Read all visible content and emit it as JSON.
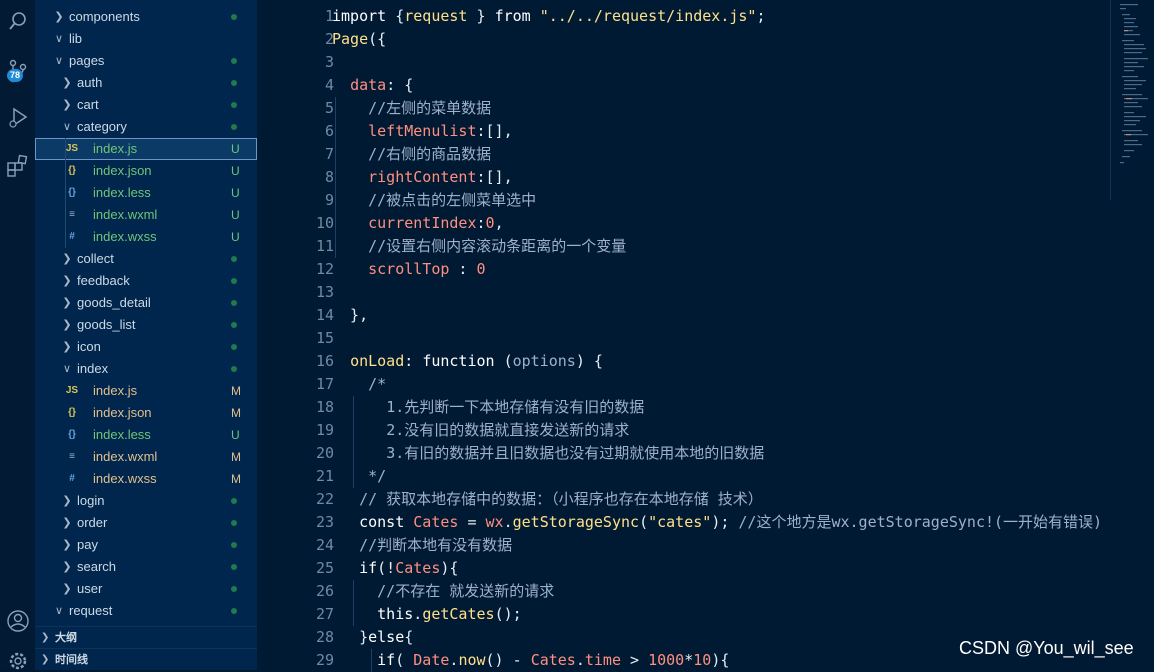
{
  "activity_bar": {
    "scm_badge": "78"
  },
  "explorer": {
    "rows": [
      {
        "label": "components",
        "kind": "folder",
        "open": false,
        "status": "dot"
      },
      {
        "label": "lib",
        "kind": "folder",
        "open": true,
        "status": ""
      },
      {
        "label": "pages",
        "kind": "folder",
        "open": true,
        "status": "dot"
      },
      {
        "label": "auth",
        "kind": "folder",
        "open": false,
        "status": "dot"
      },
      {
        "label": "cart",
        "kind": "folder",
        "open": false,
        "status": "dot"
      },
      {
        "label": "category",
        "kind": "folder",
        "open": true,
        "status": "dot"
      },
      {
        "label": "index.js",
        "kind": "js",
        "status": "U"
      },
      {
        "label": "index.json",
        "kind": "json",
        "status": "U"
      },
      {
        "label": "index.less",
        "kind": "less",
        "status": "U"
      },
      {
        "label": "index.wxml",
        "kind": "wxml",
        "status": "U"
      },
      {
        "label": "index.wxss",
        "kind": "wxss",
        "status": "U"
      },
      {
        "label": "collect",
        "kind": "folder",
        "open": false,
        "status": "dot"
      },
      {
        "label": "feedback",
        "kind": "folder",
        "open": false,
        "status": "dot"
      },
      {
        "label": "goods_detail",
        "kind": "folder",
        "open": false,
        "status": "dot"
      },
      {
        "label": "goods_list",
        "kind": "folder",
        "open": false,
        "status": "dot"
      },
      {
        "label": "icon",
        "kind": "folder",
        "open": false,
        "status": "dot"
      },
      {
        "label": "index",
        "kind": "folder",
        "open": true,
        "status": "dot"
      },
      {
        "label": "index.js",
        "kind": "js",
        "status": "M"
      },
      {
        "label": "index.json",
        "kind": "json",
        "status": "M"
      },
      {
        "label": "index.less",
        "kind": "less",
        "status": "U"
      },
      {
        "label": "index.wxml",
        "kind": "wxml",
        "status": "M"
      },
      {
        "label": "index.wxss",
        "kind": "wxss",
        "status": "M"
      },
      {
        "label": "login",
        "kind": "folder",
        "open": false,
        "status": "dot"
      },
      {
        "label": "order",
        "kind": "folder",
        "open": false,
        "status": "dot"
      },
      {
        "label": "pay",
        "kind": "folder",
        "open": false,
        "status": "dot"
      },
      {
        "label": "search",
        "kind": "folder",
        "open": false,
        "status": "dot"
      },
      {
        "label": "user",
        "kind": "folder",
        "open": false,
        "status": "dot"
      },
      {
        "label": "request",
        "kind": "folder",
        "open": true,
        "status": "dot"
      }
    ],
    "sections": [
      {
        "label": "大纲"
      },
      {
        "label": "时间线"
      }
    ]
  },
  "editor": {
    "line_numbers": [
      "1",
      "2",
      "3",
      "4",
      "5",
      "6",
      "7",
      "8",
      "9",
      "10",
      "11",
      "12",
      "13",
      "14",
      "15",
      "16",
      "17",
      "18",
      "19",
      "20",
      "21",
      "22",
      "23",
      "24",
      "25",
      "26",
      "27",
      "28",
      "29"
    ],
    "lines": [
      [
        [
          "k",
          "import "
        ],
        [
          "op",
          "{"
        ],
        [
          "fn",
          "request"
        ],
        [
          "op",
          " } "
        ],
        [
          "k",
          "from "
        ],
        [
          "str",
          "\"../../request/index.js\""
        ],
        [
          "op",
          ";"
        ]
      ],
      [
        [
          "fn",
          "Page"
        ],
        [
          "op",
          "({"
        ]
      ],
      [],
      [
        [
          "op",
          "  "
        ],
        [
          "prop",
          "data"
        ],
        [
          "op",
          ": {"
        ]
      ],
      [
        [
          "op",
          "    "
        ],
        [
          "cm",
          "//左侧的菜单数据"
        ]
      ],
      [
        [
          "op",
          "    "
        ],
        [
          "prop",
          "leftMenulist"
        ],
        [
          "op",
          ":[],"
        ]
      ],
      [
        [
          "op",
          "    "
        ],
        [
          "cm",
          "//右侧的商品数据"
        ]
      ],
      [
        [
          "op",
          "    "
        ],
        [
          "prop",
          "rightContent"
        ],
        [
          "op",
          ":[],"
        ]
      ],
      [
        [
          "op",
          "    "
        ],
        [
          "cm",
          "//被点击的左侧菜单选中"
        ]
      ],
      [
        [
          "op",
          "    "
        ],
        [
          "prop",
          "currentIndex"
        ],
        [
          "op",
          ":"
        ],
        [
          "num",
          "0"
        ],
        [
          "op",
          ","
        ]
      ],
      [
        [
          "op",
          "    "
        ],
        [
          "cm",
          "//设置右侧内容滚动条距离的一个变量"
        ]
      ],
      [
        [
          "op",
          "    "
        ],
        [
          "prop",
          "scrollTop"
        ],
        [
          "op",
          " : "
        ],
        [
          "num",
          "0"
        ]
      ],
      [],
      [
        [
          "op",
          "  },"
        ]
      ],
      [],
      [
        [
          "op",
          "  "
        ],
        [
          "fn",
          "onLoad"
        ],
        [
          "op",
          ": "
        ],
        [
          "k",
          "function "
        ],
        [
          "op",
          "("
        ],
        [
          "cm",
          "options"
        ],
        [
          "op",
          ") {"
        ]
      ],
      [
        [
          "op",
          "    "
        ],
        [
          "cm",
          "/*"
        ]
      ],
      [
        [
          "op",
          "      "
        ],
        [
          "cm",
          "1.先判断一下本地存储有没有旧的数据"
        ]
      ],
      [
        [
          "op",
          "      "
        ],
        [
          "cm",
          "2.没有旧的数据就直接发送新的请求"
        ]
      ],
      [
        [
          "op",
          "      "
        ],
        [
          "cm",
          "3.有旧的数据并且旧数据也没有过期就使用本地的旧数据"
        ]
      ],
      [
        [
          "op",
          "    "
        ],
        [
          "cm",
          "*/"
        ]
      ],
      [
        [
          "op",
          "   "
        ],
        [
          "cm",
          "// 获取本地存储中的数据：（小程序也存在本地存储 技术）"
        ]
      ],
      [
        [
          "op",
          "   "
        ],
        [
          "k",
          "const "
        ],
        [
          "prop",
          "Cates"
        ],
        [
          "op",
          " = "
        ],
        [
          "prop",
          "wx"
        ],
        [
          "op",
          "."
        ],
        [
          "fn",
          "getStorageSync"
        ],
        [
          "op",
          "("
        ],
        [
          "str",
          "\"cates\""
        ],
        [
          "op",
          ");"
        ],
        [
          "cm",
          " //这个地方是wx.getStorageSync!(一开始有错误)"
        ]
      ],
      [
        [
          "op",
          "   "
        ],
        [
          "cm",
          "//判断本地有没有数据"
        ]
      ],
      [
        [
          "op",
          "   "
        ],
        [
          "k",
          "if"
        ],
        [
          "op",
          "(!"
        ],
        [
          "prop",
          "Cates"
        ],
        [
          "op",
          "){"
        ]
      ],
      [
        [
          "op",
          "     "
        ],
        [
          "cm",
          "//不存在 就发送新的请求"
        ]
      ],
      [
        [
          "op",
          "     "
        ],
        [
          "k",
          "this"
        ],
        [
          "op",
          "."
        ],
        [
          "fn",
          "getCates"
        ],
        [
          "op",
          "();"
        ]
      ],
      [
        [
          "op",
          "   "
        ],
        [
          "op",
          "}"
        ],
        [
          "k",
          "else"
        ],
        [
          "op",
          "{"
        ]
      ],
      [
        [
          "op",
          "     "
        ],
        [
          "k",
          "if"
        ],
        [
          "op",
          "( "
        ],
        [
          "prop",
          "Date"
        ],
        [
          "op",
          "."
        ],
        [
          "fn",
          "now"
        ],
        [
          "op",
          "() - "
        ],
        [
          "prop",
          "Cates"
        ],
        [
          "op",
          "."
        ],
        [
          "prop",
          "time"
        ],
        [
          "op",
          " > "
        ],
        [
          "num",
          "1000"
        ],
        [
          "op",
          "*"
        ],
        [
          "num",
          "10"
        ],
        [
          "op",
          "){"
        ]
      ]
    ]
  },
  "watermark": "CSDN @You_wil_see",
  "colors": {
    "background": "#011a33",
    "sidebar": "#00264d",
    "keyword": "#ffffff",
    "function": "#ffe08a",
    "property": "#ff8f80",
    "comment": "#9fb1c9",
    "git_untracked": "#71c47a",
    "git_modified": "#e2c08d"
  }
}
